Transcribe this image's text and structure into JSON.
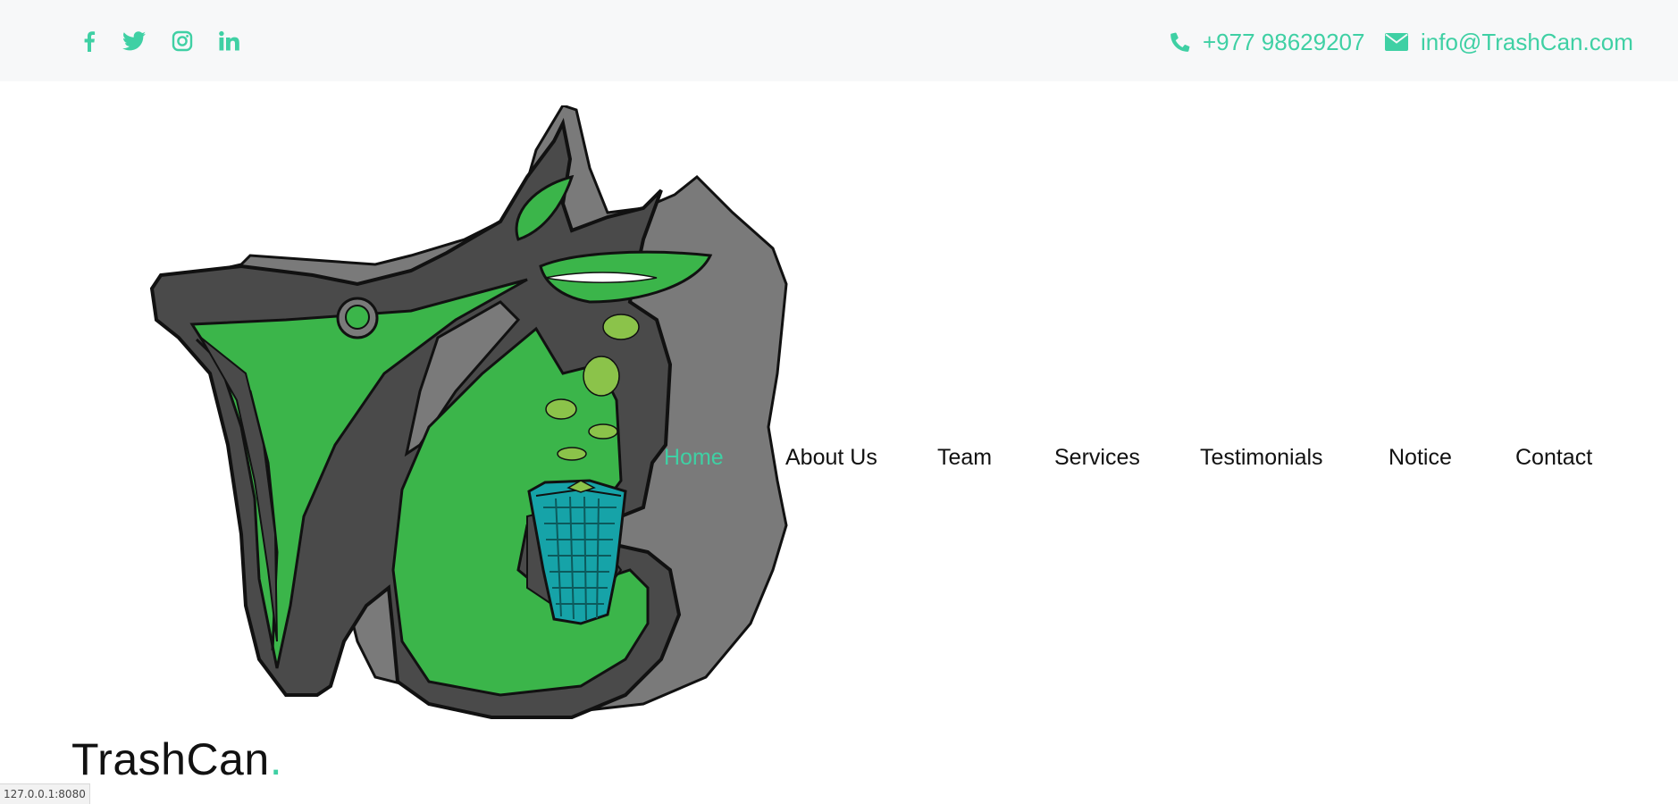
{
  "topbar": {
    "socials": [
      {
        "icon": "facebook-icon"
      },
      {
        "icon": "twitter-icon"
      },
      {
        "icon": "instagram-icon"
      },
      {
        "icon": "linkedin-icon"
      }
    ],
    "phone": {
      "icon": "phone-icon",
      "text": "+977 98629207"
    },
    "email": {
      "icon": "envelope-icon",
      "text": "info@TrashCan.com"
    }
  },
  "logo": {
    "icon": "trashcan-logo-art"
  },
  "nav": {
    "items": [
      {
        "label": "Home",
        "active": true
      },
      {
        "label": "About Us",
        "active": false
      },
      {
        "label": "Team",
        "active": false
      },
      {
        "label": "Services",
        "active": false
      },
      {
        "label": "Testimonials",
        "active": false
      },
      {
        "label": "Notice",
        "active": false
      },
      {
        "label": "Contact",
        "active": false
      }
    ]
  },
  "brand": {
    "name": "TrashCan",
    "dot": "."
  },
  "status_bar": {
    "url": "127.0.0.1:8080"
  },
  "colors": {
    "accent": "#3fd0a4",
    "logo_green": "#3bb54a",
    "logo_dark": "#4a4a4a",
    "logo_gray": "#7a7a7a"
  }
}
